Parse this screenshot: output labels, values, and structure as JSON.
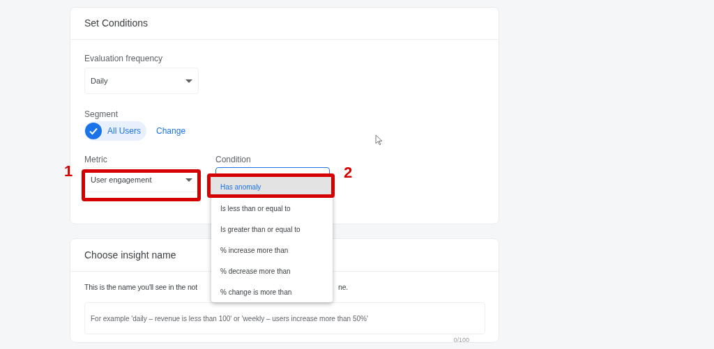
{
  "set_conditions": {
    "title": "Set Conditions",
    "frequency": {
      "label": "Evaluation frequency",
      "value": "Daily"
    },
    "segment": {
      "label": "Segment",
      "chip": "All Users",
      "selected": true,
      "change_link": "Change"
    },
    "metric": {
      "label": "Metric",
      "value": "User engagement"
    },
    "condition": {
      "label": "Condition",
      "expanded": true,
      "options": [
        {
          "label": "Has anomaly",
          "selected": true
        },
        {
          "label": "Is less than or equal to",
          "selected": false
        },
        {
          "label": "Is greater than or equal to",
          "selected": false
        },
        {
          "label": "% increase more than",
          "selected": false
        },
        {
          "label": "% decrease more than",
          "selected": false
        },
        {
          "label": "% change is more than",
          "selected": false
        }
      ]
    }
  },
  "insight_name": {
    "title": "Choose insight name",
    "description_parts": [
      "This is the name you'll see in the not",
      "ne."
    ],
    "placeholder": "For example 'daily – revenue is less than 100' or 'weekly – users increase more than 50%'",
    "counter": "0/100"
  },
  "annotations": [
    {
      "label": "1"
    },
    {
      "label": "2"
    }
  ]
}
